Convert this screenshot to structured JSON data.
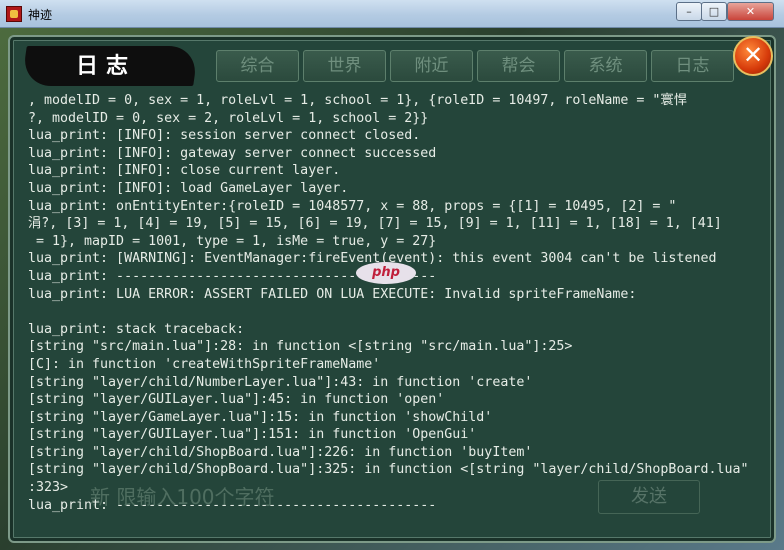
{
  "window": {
    "title": "神迹",
    "min_glyph": "–",
    "max_glyph": "□",
    "close_glyph": "✕"
  },
  "panel": {
    "title": "日志",
    "close_glyph": "✕",
    "tabs": [
      "综合",
      "世界",
      "附近",
      "帮会",
      "系统",
      "日志"
    ],
    "input_placeholder": "新 限输入100个字符",
    "send_label": "发送"
  },
  "watermark": "php",
  "log_lines": [
    ", modelID = 0, sex = 1, roleLvl = 1, school = 1}, {roleID = 10497, roleName = \"寰悍",
    "?, modelID = 0, sex = 2, roleLvl = 1, school = 2}}",
    "lua_print: [INFO]: session server connect closed.",
    "lua_print: [INFO]: gateway server connect successed",
    "lua_print: [INFO]: close current layer.",
    "lua_print: [INFO]: load GameLayer layer.",
    "lua_print: onEntityEnter:{roleID = 1048577, x = 88, props = {[1] = 10495, [2] = \"",
    "涓?, [3] = 1, [4] = 19, [5] = 15, [6] = 19, [7] = 15, [9] = 1, [11] = 1, [18] = 1, [41]",
    " = 1}, mapID = 1001, type = 1, isMe = true, y = 27}",
    "lua_print: [WARNING]: EventManager:fireEvent(event): this event 3004 can't be listened",
    "lua_print: ----------------------------------------",
    "lua_print: LUA ERROR: ASSERT FAILED ON LUA EXECUTE: Invalid spriteFrameName:",
    "",
    "lua_print: stack traceback:",
    "[string \"src/main.lua\"]:28: in function <[string \"src/main.lua\"]:25>",
    "[C]: in function 'createWithSpriteFrameName'",
    "[string \"layer/child/NumberLayer.lua\"]:43: in function 'create'",
    "[string \"layer/GUILayer.lua\"]:45: in function 'open'",
    "[string \"layer/GameLayer.lua\"]:15: in function 'showChild'",
    "[string \"layer/GUILayer.lua\"]:151: in function 'OpenGui'",
    "[string \"layer/child/ShopBoard.lua\"]:226: in function 'buyItem'",
    "[string \"layer/child/ShopBoard.lua\"]:325: in function <[string \"layer/child/ShopBoard.lua\"",
    ":323>",
    "lua_print: ----------------------------------------"
  ]
}
